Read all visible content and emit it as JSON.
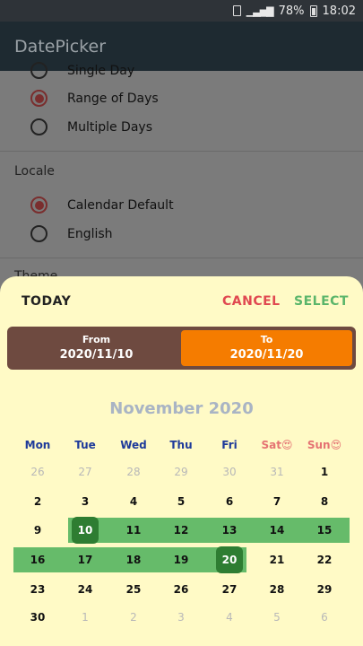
{
  "status": {
    "battery": "78%",
    "time": "18:02"
  },
  "appbar": {
    "title": "DatePicker"
  },
  "settings": {
    "options_top": [
      "Single Day",
      "Range of Days",
      "Multiple Days"
    ],
    "selected_top": "Range of Days",
    "locale_label": "Locale",
    "locale_options": [
      "Calendar Default",
      "English"
    ],
    "selected_locale": "Calendar Default",
    "theme_label": "Theme"
  },
  "sheet": {
    "today": "TODAY",
    "cancel": "CANCEL",
    "select": "SELECT",
    "from_label": "From",
    "from_date": "2020/11/10",
    "to_label": "To",
    "to_date": "2020/11/20",
    "month": "November 2020",
    "weekdays": [
      "Mon",
      "Tue",
      "Wed",
      "Thu",
      "Fri",
      "Sat😍",
      "Sun😍"
    ],
    "weekday_colors": [
      "#1e3a9a",
      "#1e3a9a",
      "#1e3a9a",
      "#1e3a9a",
      "#1e3a9a",
      "#e57373",
      "#e57373"
    ],
    "weeks": [
      [
        "26",
        "27",
        "28",
        "29",
        "30",
        "31",
        "1"
      ],
      [
        "2",
        "3",
        "4",
        "5",
        "6",
        "7",
        "8"
      ],
      [
        "9",
        "10",
        "11",
        "12",
        "13",
        "14",
        "15"
      ],
      [
        "16",
        "17",
        "18",
        "19",
        "20",
        "21",
        "22"
      ],
      [
        "23",
        "24",
        "25",
        "26",
        "27",
        "28",
        "29"
      ],
      [
        "30",
        "1",
        "2",
        "3",
        "4",
        "5",
        "6"
      ]
    ],
    "range_start": "10",
    "range_end": "20",
    "range_color": "#66bb6a",
    "endpoint_color": "#2e7d32",
    "accent_to": "#f57c00"
  }
}
